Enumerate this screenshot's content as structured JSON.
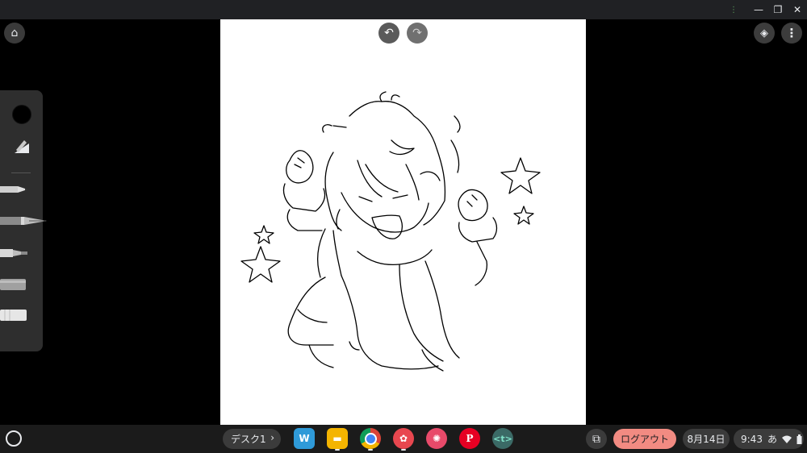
{
  "shelf": {
    "desk_label": "デスク1",
    "desk_chevron": "›",
    "apps": [
      {
        "name": "word-app",
        "glyph": "W",
        "color": "#2f9ad8"
      },
      {
        "name": "slides-app",
        "glyph": "▬",
        "color": "#f4b400"
      },
      {
        "name": "chrome-app",
        "glyph": "●",
        "color": "#db4437"
      },
      {
        "name": "paint-app",
        "glyph": "✿",
        "color": "#e8474f"
      },
      {
        "name": "art-app",
        "glyph": "✺",
        "color": "#e84a6a"
      },
      {
        "name": "pinterest-app",
        "glyph": "P",
        "color": "#e60023"
      },
      {
        "name": "terminal-app",
        "glyph": "<t>",
        "color": "#3b6a66"
      }
    ],
    "logout_label": "ログアウト",
    "date": "8月14日",
    "time": "9:43",
    "ime": "あ"
  },
  "toolbar": {
    "undo_icon": "↶",
    "redo_icon": "↷",
    "home_icon": "⌂",
    "layers_icon": "◈",
    "more_icon": "⋮"
  },
  "window": {
    "minimize_icon": "—",
    "restore_icon": "❐",
    "close_icon": "✕"
  },
  "colors": {
    "logout_bg": "#f28b82",
    "canvas": "#ffffff",
    "shelf": "#1b1b1b"
  }
}
